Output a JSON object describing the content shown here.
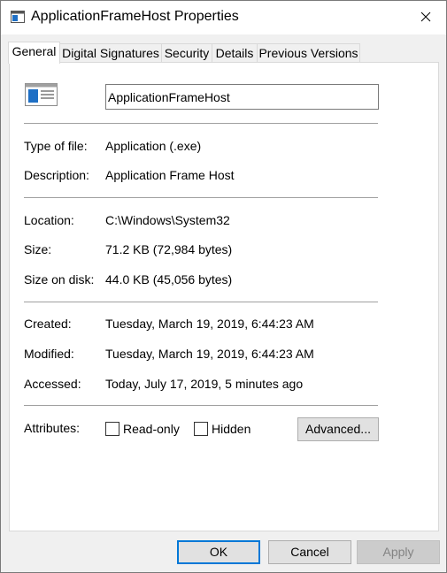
{
  "window": {
    "title": "ApplicationFrameHost Properties"
  },
  "tabs": [
    {
      "label": "General"
    },
    {
      "label": "Digital Signatures"
    },
    {
      "label": "Security"
    },
    {
      "label": "Details"
    },
    {
      "label": "Previous Versions"
    }
  ],
  "general": {
    "file_name": "ApplicationFrameHost",
    "type_label": "Type of file:",
    "type_value": "Application (.exe)",
    "description_label": "Description:",
    "description_value": "Application Frame Host",
    "location_label": "Location:",
    "location_value": "C:\\Windows\\System32",
    "size_label": "Size:",
    "size_value": "71.2 KB (72,984 bytes)",
    "size_on_disk_label": "Size on disk:",
    "size_on_disk_value": "44.0 KB (45,056 bytes)",
    "created_label": "Created:",
    "created_value": "Tuesday, March 19, 2019, 6:44:23 AM",
    "modified_label": "Modified:",
    "modified_value": "Tuesday, March 19, 2019, 6:44:23 AM",
    "accessed_label": "Accessed:",
    "accessed_value": "Today, July 17, 2019, 5 minutes ago",
    "attributes_label": "Attributes:",
    "readonly_label": "Read-only",
    "readonly_checked": false,
    "hidden_label": "Hidden",
    "hidden_checked": false,
    "advanced_label": "Advanced..."
  },
  "buttons": {
    "ok": "OK",
    "cancel": "Cancel",
    "apply": "Apply"
  },
  "colors": {
    "accent": "#0078d7",
    "icon_blue": "#1e6fc5"
  }
}
